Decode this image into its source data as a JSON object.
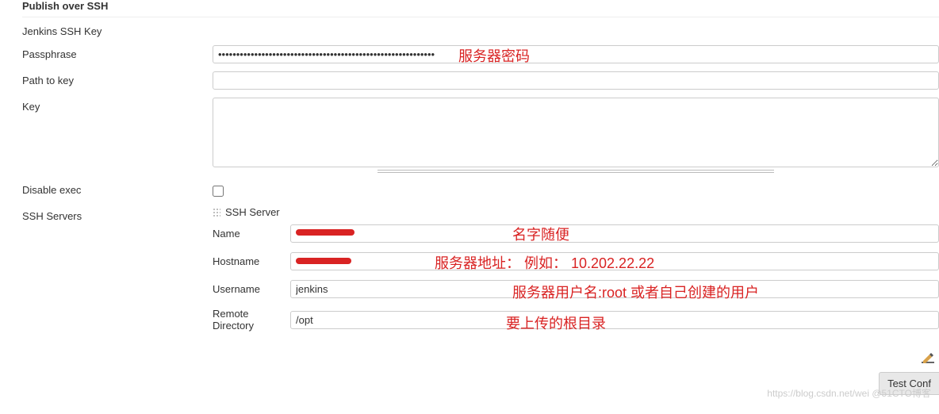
{
  "topPartial": "",
  "sectionTitle": "Publish over SSH",
  "jenkinsSshKeyHeader": "Jenkins SSH Key",
  "labels": {
    "passphrase": "Passphrase",
    "pathToKey": "Path to key",
    "key": "Key",
    "disableExec": "Disable exec",
    "sshServers": "SSH Servers"
  },
  "sshServer": {
    "header": "SSH Server",
    "nameLabel": "Name",
    "hostnameLabel": "Hostname",
    "usernameLabel": "Username",
    "remoteDirLabel": "Remote Directory",
    "nameValue": "",
    "hostnameValue": "",
    "usernameValue": "jenkins",
    "remoteDirValue": "/opt"
  },
  "passphraseValue": "••••••••••••••••••••••••••••••••••••••••••••••••••••••••••••",
  "pathToKeyValue": "",
  "keyValue": "",
  "disableExecChecked": false,
  "annotations": {
    "serverPassword": "服务器密码",
    "nameFree": "名字随便",
    "serverAddress": "服务器地址： 例如： 10.202.22.22",
    "serverUsername": "服务器用户名:root 或者自己创建的用户",
    "uploadRoot": "要上传的根目录"
  },
  "testConfigLabel": "Test Conf",
  "watermark": "https://blog.csdn.net/wei @51CTO博客"
}
